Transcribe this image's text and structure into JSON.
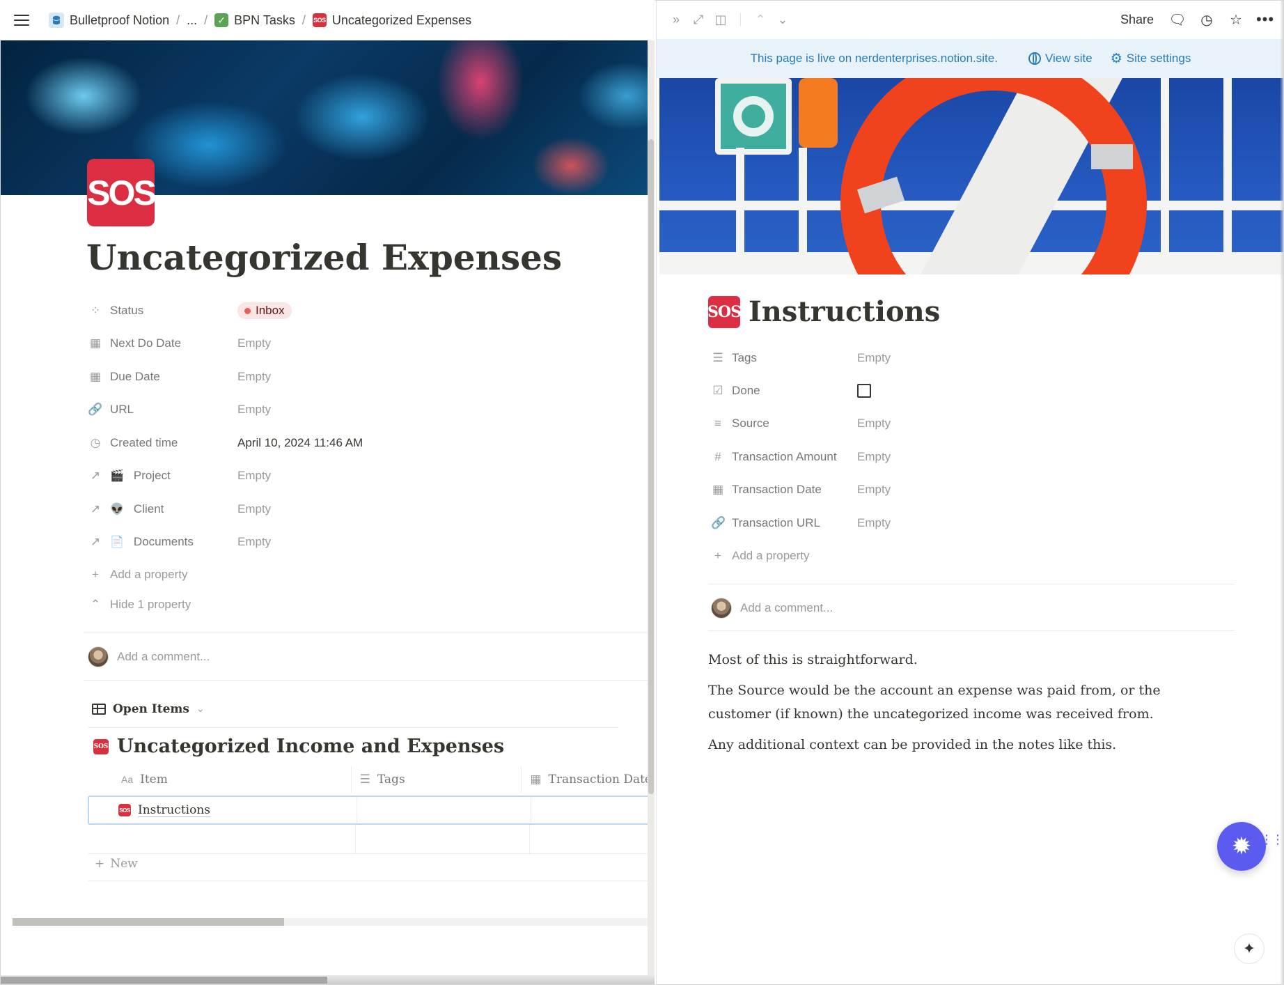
{
  "breadcrumb": {
    "workspace": "Bulletproof Notion",
    "ellipsis": "...",
    "tasks": "BPN Tasks",
    "page": "Uncategorized Expenses",
    "separator": "/"
  },
  "left_page": {
    "icon_text": "SOS",
    "title": "Uncategorized Expenses",
    "properties": [
      {
        "label": "Status",
        "icon": "status-icon",
        "value": "Inbox"
      },
      {
        "label": "Next Do Date",
        "icon": "calendar-icon",
        "value": "Empty"
      },
      {
        "label": "Due Date",
        "icon": "calendar-icon",
        "value": "Empty"
      },
      {
        "label": "URL",
        "icon": "link-icon",
        "value": "Empty"
      },
      {
        "label": "Created time",
        "icon": "clock-icon",
        "value": "April 10, 2024 11:46 AM"
      },
      {
        "label": "Project",
        "icon": "relation-arrow-icon",
        "value": "Empty"
      },
      {
        "label": "Client",
        "icon": "relation-arrow-icon",
        "value": "Empty"
      },
      {
        "label": "Documents",
        "icon": "relation-arrow-icon",
        "value": "Empty"
      }
    ],
    "add_property": "Add a property",
    "hide_property": "Hide 1 property",
    "comment_placeholder": "Add a comment...",
    "view_name": "Open Items",
    "database_title": "Uncategorized Income and Expenses",
    "table_columns": [
      "Item",
      "Tags",
      "Transaction Date"
    ],
    "table_rows": [
      {
        "item": "Instructions"
      }
    ],
    "new_row_label": "New",
    "status_color": "#e16259"
  },
  "peek": {
    "share_label": "Share",
    "banner_text": "This page is live on nerdenterprises.notion.site.",
    "view_site": "View site",
    "site_settings": "Site settings",
    "icon_text": "SOS",
    "title": "Instructions",
    "properties": [
      {
        "label": "Tags",
        "icon": "list-icon",
        "value": "Empty"
      },
      {
        "label": "Done",
        "icon": "checkbox-icon",
        "value": false
      },
      {
        "label": "Source",
        "icon": "text-icon",
        "value": "Empty"
      },
      {
        "label": "Transaction Amount",
        "icon": "number-icon",
        "value": "Empty"
      },
      {
        "label": "Transaction Date",
        "icon": "calendar-icon",
        "value": "Empty"
      },
      {
        "label": "Transaction URL",
        "icon": "link-icon",
        "value": "Empty"
      }
    ],
    "add_property": "Add a property",
    "comment_placeholder": "Add a comment...",
    "paragraphs": [
      "Most of this is straightforward.",
      "The Source would be the account an expense was paid from, or the customer (if known) the uncategorized income was received from.",
      "Any additional context can be provided in the notes like this."
    ],
    "accent_color": "#5b5bf0",
    "banner_color": "#2b7bb9"
  }
}
